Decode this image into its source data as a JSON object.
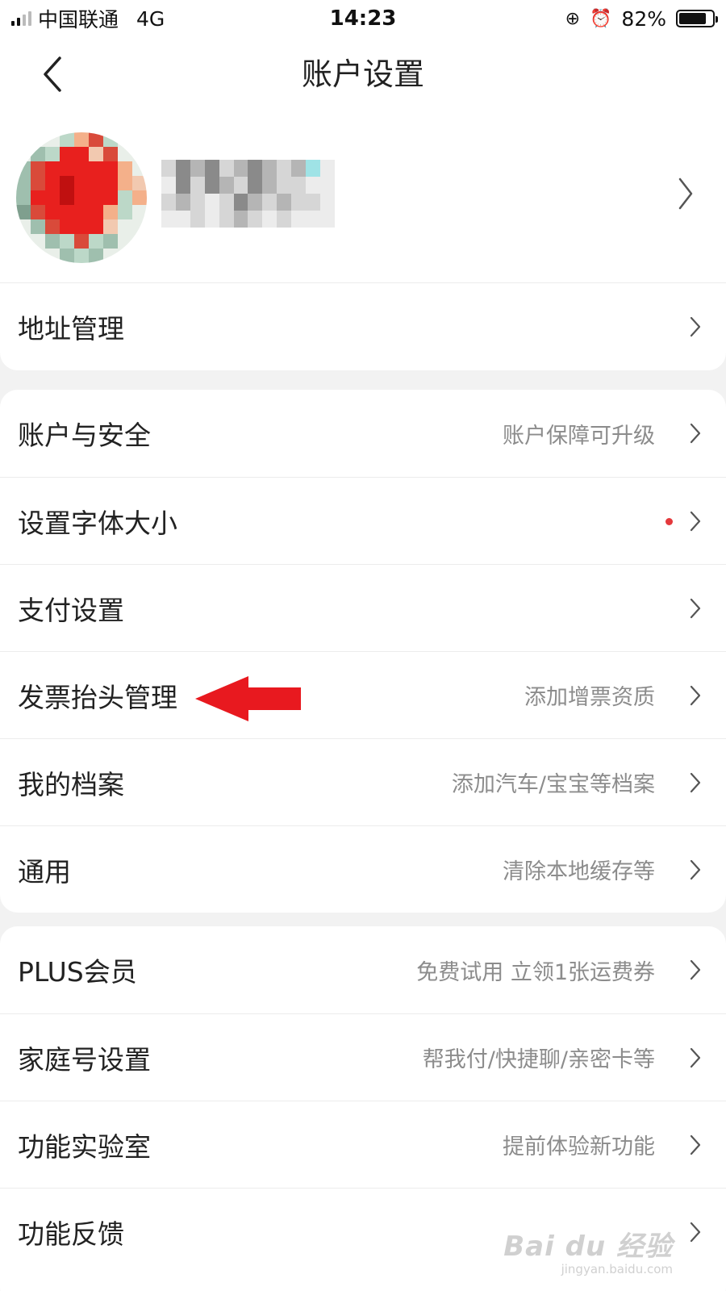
{
  "status_bar": {
    "carrier": "中国联通",
    "network": "4G",
    "time": "14:23",
    "battery": "82%",
    "battery_level": 0.82,
    "lock_icon": "rotation-lock-icon",
    "alarm_icon": "alarm-clock-icon"
  },
  "nav": {
    "title": "账户设置",
    "back_icon": "chevron-left-icon"
  },
  "profile": {
    "avatar": "pixelated-avatar",
    "name_obscured": true
  },
  "section1": [
    {
      "label": "地址管理",
      "value": ""
    }
  ],
  "section2": [
    {
      "label": "账户与安全",
      "value": "账户保障可升级"
    },
    {
      "label": "设置字体大小",
      "value": ""
    },
    {
      "label": "支付设置",
      "value": ""
    },
    {
      "label": "发票抬头管理",
      "value": "添加增票资质"
    },
    {
      "label": "我的档案",
      "value": "添加汽车/宝宝等档案"
    },
    {
      "label": "通用",
      "value": "清除本地缓存等"
    }
  ],
  "section3": [
    {
      "label": "PLUS会员",
      "value": "免费试用 立领1张运费券"
    },
    {
      "label": "家庭号设置",
      "value": "帮我付/快捷聊/亲密卡等"
    },
    {
      "label": "功能实验室",
      "value": "提前体验新功能"
    },
    {
      "label": "功能反馈",
      "value": ""
    }
  ],
  "annotation": {
    "arrow_color": "#e8191f",
    "target": "发票抬头管理"
  },
  "colors": {
    "accent_red": "#e4393c",
    "background": "#f2f2f2"
  },
  "watermark": {
    "main": "Bai du 经验",
    "sub": "jingyan.baidu.com"
  }
}
